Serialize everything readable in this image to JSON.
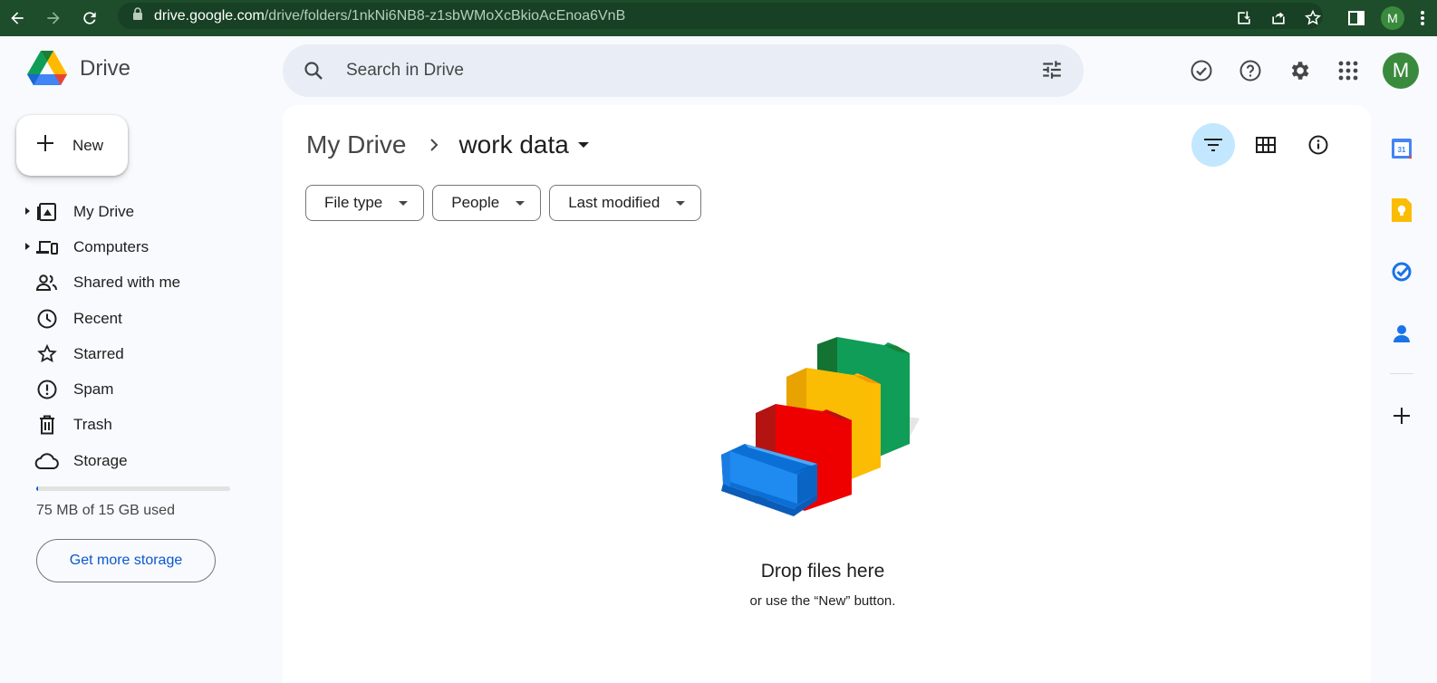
{
  "browser": {
    "url_host": "drive.google.com",
    "url_path": "/drive/folders/1nkNi6NB8-z1sbWMoXcBkioAcEnoa6VnB",
    "profile_initial": "M"
  },
  "app": {
    "name": "Drive",
    "search_placeholder": "Search in Drive",
    "account_initial": "M"
  },
  "sidebar": {
    "new_label": "New",
    "items": [
      {
        "label": "My Drive",
        "icon": "my-drive-icon",
        "expandable": true
      },
      {
        "label": "Computers",
        "icon": "computers-icon",
        "expandable": true
      },
      {
        "label": "Shared with me",
        "icon": "shared-icon",
        "expandable": false
      },
      {
        "label": "Recent",
        "icon": "clock-icon",
        "expandable": false
      },
      {
        "label": "Starred",
        "icon": "star-icon",
        "expandable": false
      },
      {
        "label": "Spam",
        "icon": "spam-icon",
        "expandable": false
      },
      {
        "label": "Trash",
        "icon": "trash-icon",
        "expandable": false
      },
      {
        "label": "Storage",
        "icon": "cloud-icon",
        "expandable": false
      }
    ],
    "storage_used_fraction": 0.005,
    "storage_text": "75 MB of 15 GB used",
    "get_more_label": "Get more storage"
  },
  "main": {
    "breadcrumb_root": "My Drive",
    "breadcrumb_current": "work data",
    "filters": [
      "File type",
      "People",
      "Last modified"
    ],
    "empty_title": "Drop files here",
    "empty_subtitle": "or use the “New” button."
  },
  "colors": {
    "accent": "#0b57d0",
    "active_bg": "#c2e7ff",
    "chrome_bg": "#1e4d2b"
  }
}
